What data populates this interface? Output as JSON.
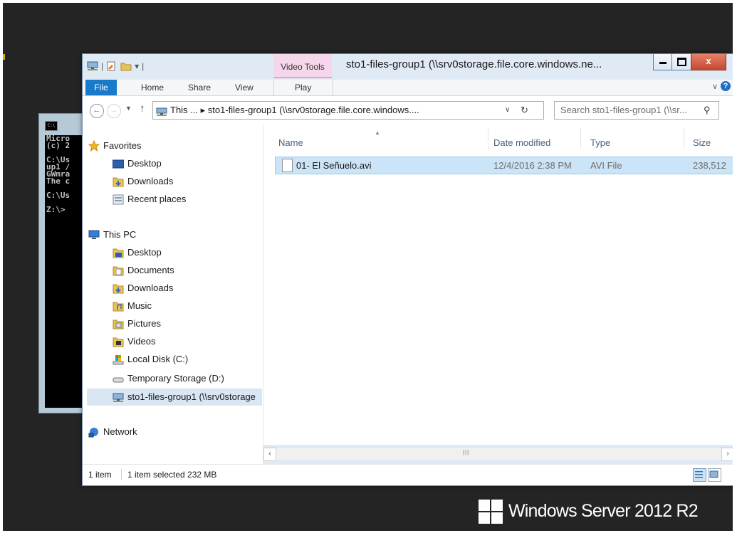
{
  "os": {
    "brand": "Windows Server 2012 R2"
  },
  "cmd": {
    "lines": [
      "Micro",
      "(c) 2",
      "",
      "C:\\Us",
      "up1 /",
      "GWmra",
      "The c",
      "",
      "C:\\Us",
      "",
      "Z:\\>"
    ]
  },
  "window": {
    "title": "sto1-files-group1 (\\\\srv0storage.file.core.windows.ne...",
    "contextual_tab": "Video Tools",
    "close_glyph": "x"
  },
  "ribbon": {
    "tabs": {
      "file": "File",
      "home": "Home",
      "share": "Share",
      "view": "View",
      "play": "Play"
    },
    "help": "?"
  },
  "address": {
    "path": "This ...  ▸  sto1-files-group1 (\\\\srv0storage.file.core.windows....",
    "lead": "▸"
  },
  "search": {
    "placeholder": "Search sto1-files-group1 (\\\\sr..."
  },
  "nav": {
    "favorites": "Favorites",
    "fav_items": [
      "Desktop",
      "Downloads",
      "Recent places"
    ],
    "thispc": "This PC",
    "pc_items": [
      "Desktop",
      "Documents",
      "Downloads",
      "Music",
      "Pictures",
      "Videos",
      "Local Disk (C:)",
      "Temporary Storage (D:)",
      "sto1-files-group1 (\\\\srv0storage"
    ],
    "network": "Network"
  },
  "columns": {
    "name": "Name",
    "date": "Date modified",
    "type": "Type",
    "size": "Size"
  },
  "files": [
    {
      "name": "01- El Señuelo.avi",
      "date": "12/4/2016 2:38 PM",
      "type": "AVI File",
      "size": "238,512"
    }
  ],
  "status": {
    "count": "1 item",
    "selection": "1 item selected  232 MB"
  },
  "colors": {
    "accent": "#1979ca",
    "selection": "#cce4f7",
    "contextual_tab": "#f6d6ea",
    "close_button": "#c24a32"
  }
}
